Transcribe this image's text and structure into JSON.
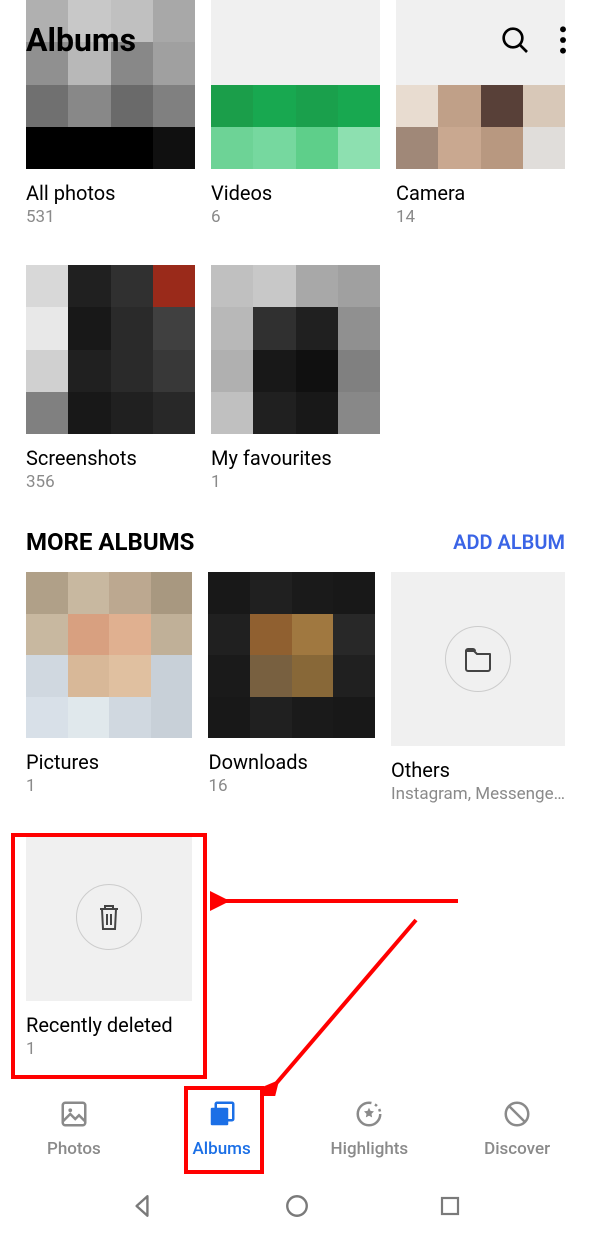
{
  "header": {
    "title": "Albums"
  },
  "albums_main": [
    {
      "title": "All photos",
      "count": "531"
    },
    {
      "title": "Videos",
      "count": "6"
    },
    {
      "title": "Camera",
      "count": "14"
    },
    {
      "title": "Screenshots",
      "count": "356"
    },
    {
      "title": "My favourites",
      "count": "1"
    }
  ],
  "section": {
    "title": "MORE ALBUMS",
    "add_label": "ADD ALBUM"
  },
  "albums_more": [
    {
      "title": "Pictures",
      "count": "1"
    },
    {
      "title": "Downloads",
      "count": "16"
    },
    {
      "title": "Others",
      "sub": "Instagram, Messenge…"
    },
    {
      "title": "Recently deleted",
      "count": "1"
    }
  ],
  "nav": {
    "photos": "Photos",
    "albums": "Albums",
    "highlights": "Highlights",
    "discover": "Discover"
  }
}
